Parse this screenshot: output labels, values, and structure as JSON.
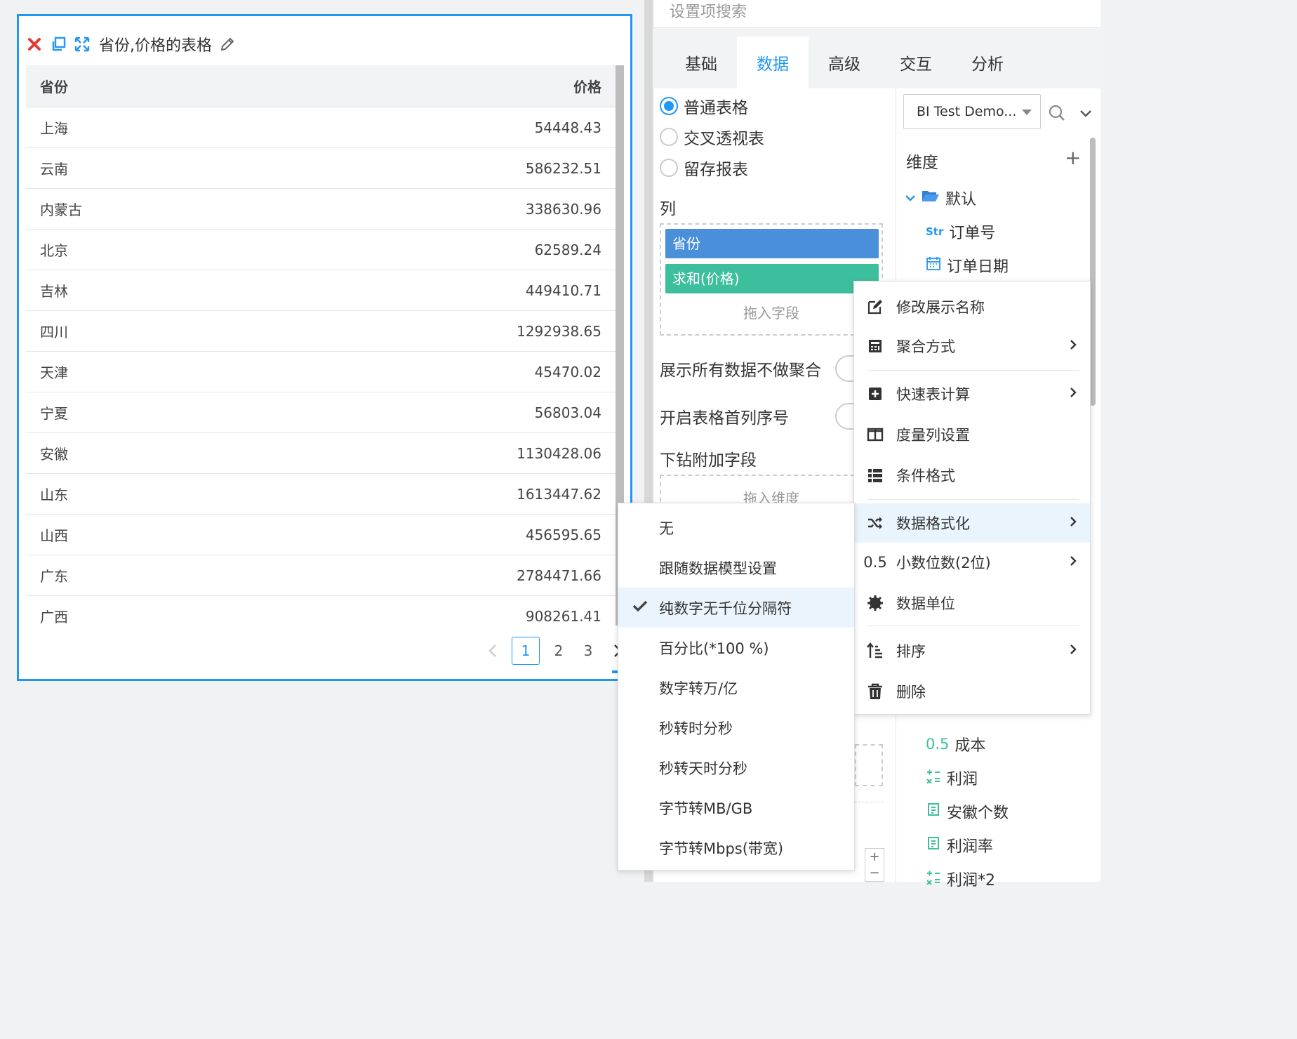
{
  "widget": {
    "title": "省份,价格的表格",
    "table": {
      "columns": [
        "省份",
        "价格"
      ],
      "rows": [
        [
          "上海",
          "54448.43"
        ],
        [
          "云南",
          "586232.51"
        ],
        [
          "内蒙古",
          "338630.96"
        ],
        [
          "北京",
          "62589.24"
        ],
        [
          "吉林",
          "449410.71"
        ],
        [
          "四川",
          "1292938.65"
        ],
        [
          "天津",
          "45470.02"
        ],
        [
          "宁夏",
          "56803.04"
        ],
        [
          "安徽",
          "1130428.06"
        ],
        [
          "山东",
          "1613447.62"
        ],
        [
          "山西",
          "456595.65"
        ],
        [
          "广东",
          "2784471.66"
        ],
        [
          "广西",
          "908261.41"
        ]
      ]
    },
    "pagination": {
      "pages": [
        "1",
        "2",
        "3"
      ],
      "current": "1"
    }
  },
  "panel": {
    "search_placeholder": "设置项搜索",
    "tabs": [
      "基础",
      "数据",
      "高级",
      "交互",
      "分析"
    ],
    "active_tab": "数据",
    "table_types": [
      {
        "label": "普通表格",
        "selected": true
      },
      {
        "label": "交叉透视表",
        "selected": false
      },
      {
        "label": "留存报表",
        "selected": false
      }
    ],
    "columns_label": "列",
    "column_fields": [
      {
        "label": "省份",
        "color": "#4a8fd9"
      },
      {
        "label": "求和(价格)",
        "color": "#3dbf9e"
      }
    ],
    "drop_field_hint": "拖入字段",
    "show_all_label": "展示所有数据不做聚合",
    "row_number_label": "开启表格首列序号",
    "drill_label": "下钻附加字段",
    "drop_dim_hint": "拖入维度",
    "datasource": "BI Test Demo...",
    "dimension_label": "维度",
    "folder_label": "默认",
    "dimensions": [
      {
        "type": "Str",
        "label": "订单号"
      },
      {
        "type": "date",
        "label": "订单日期"
      }
    ],
    "measures": [
      {
        "type": "0.5",
        "label": "成本"
      },
      {
        "type": "calc",
        "label": "利润"
      },
      {
        "type": "count",
        "label": "安徽个数"
      },
      {
        "type": "count",
        "label": "利润率"
      },
      {
        "type": "calc",
        "label": "利润*2"
      }
    ]
  },
  "context_menu": {
    "items": [
      {
        "label": "修改展示名称",
        "icon": "edit-icon",
        "arrow": false
      },
      {
        "label": "聚合方式",
        "icon": "calculator-icon",
        "arrow": true
      },
      {
        "label": "快速表计算",
        "icon": "plus-square-icon",
        "arrow": true
      },
      {
        "label": "度量列设置",
        "icon": "columns-icon",
        "arrow": false
      },
      {
        "label": "条件格式",
        "icon": "list-icon",
        "arrow": false
      },
      {
        "label": "数据格式化",
        "icon": "shuffle-icon",
        "arrow": true,
        "highlighted": true
      },
      {
        "label": "小数位数(2位)",
        "icon": "0.5",
        "arrow": true
      },
      {
        "label": "数据单位",
        "icon": "gear-icon",
        "arrow": false
      },
      {
        "label": "排序",
        "icon": "sort-icon",
        "arrow": true
      },
      {
        "label": "删除",
        "icon": "trash-icon",
        "arrow": false
      }
    ]
  },
  "format_submenu": {
    "items": [
      {
        "label": "无"
      },
      {
        "label": "跟随数据模型设置"
      },
      {
        "label": "纯数字无千位分隔符",
        "checked": true
      },
      {
        "label": "百分比(*100 %)"
      },
      {
        "label": "数字转万/亿"
      },
      {
        "label": "秒转时分秒"
      },
      {
        "label": "秒转天时分秒"
      },
      {
        "label": "字节转MB/GB"
      },
      {
        "label": "字节转Mbps(带宽)"
      }
    ]
  }
}
